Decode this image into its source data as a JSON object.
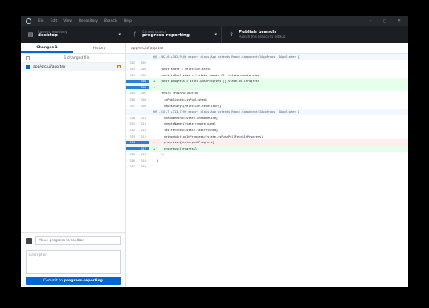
{
  "menubar": {
    "items": [
      "File",
      "Edit",
      "View",
      "Repository",
      "Branch",
      "Help"
    ],
    "window_controls": [
      "–",
      "▢",
      "✕"
    ]
  },
  "toolbar": {
    "repo": {
      "small": "Current repository",
      "big": "desktop"
    },
    "branch": {
      "small": "Current branch",
      "big": "progress-reporting"
    },
    "publish": {
      "big": "Publish branch",
      "small": "Publish this branch to GitHub"
    }
  },
  "sidebar": {
    "tabs": [
      "Changes 1",
      "History"
    ],
    "changed_label": "1 changed file",
    "files": [
      {
        "name": "app/src/ui/app.tsx"
      }
    ]
  },
  "commit": {
    "summary_placeholder": "Move progress to toolbar",
    "description_placeholder": "Description",
    "button_prefix": "Commit to",
    "button_branch": "progress-reporting"
  },
  "diff": {
    "path": "app/src/ui/app.tsx",
    "lines": [
      {
        "type": "hunk",
        "old": "",
        "new": "",
        "code": "@@ -302,6 +302,9 @@ export class App extends React.Component<IAppProps, IAppState> {"
      },
      {
        "type": "ctx",
        "old": "302",
        "new": "302",
        "code": ""
      },
      {
        "type": "ctx",
        "old": "303",
        "new": "303",
        "code": "    const state = selection.state"
      },
      {
        "type": "ctx",
        "old": "304",
        "new": "304",
        "code": "    const isPublished = !!state.remote && !!state.remote.name"
      },
      {
        "type": "add",
        "old": "",
        "new": "305",
        "code": "+   const progress = state.pushProgress || state.pullProgress"
      },
      {
        "type": "add",
        "old": "",
        "new": "306",
        "code": "+"
      },
      {
        "type": "ctx",
        "old": "305",
        "new": "307",
        "code": "    return <PushPullButton"
      },
      {
        "type": "ctx",
        "old": "306",
        "new": "308",
        "code": "      isPublished={isPublished}"
      },
      {
        "type": "ctx",
        "old": "307",
        "new": "309",
        "code": "      repository={selection.repository}"
      },
      {
        "type": "hunk",
        "old": "",
        "new": "",
        "code": "@@ -310,7 +313,7 @@ export class App extends React.Component<IAppProps, IAppState> {"
      },
      {
        "type": "ctx",
        "old": "310",
        "new": "313",
        "code": "      aheadBehind={state.aheadBehind}"
      },
      {
        "type": "ctx",
        "old": "311",
        "new": "314",
        "code": "      remoteName={state.remote.name}"
      },
      {
        "type": "ctx",
        "old": "312",
        "new": "315",
        "code": "      lastFetched={state.lastFetched}"
      },
      {
        "type": "ctx",
        "old": "313",
        "new": "316",
        "code": "      networkActionInProgress={state.isPushPullFetchInProgress}"
      },
      {
        "type": "del",
        "old": "314",
        "new": "",
        "code": "-     progress={state.pushProgress}"
      },
      {
        "type": "add",
        "old": "",
        "new": "317",
        "code": "+     progress={progress}"
      },
      {
        "type": "ctx",
        "old": "315",
        "new": "318",
        "code": "    />"
      },
      {
        "type": "ctx",
        "old": "316",
        "new": "319",
        "code": "  }"
      },
      {
        "type": "ctx",
        "old": "317",
        "new": "320",
        "code": ""
      }
    ]
  }
}
